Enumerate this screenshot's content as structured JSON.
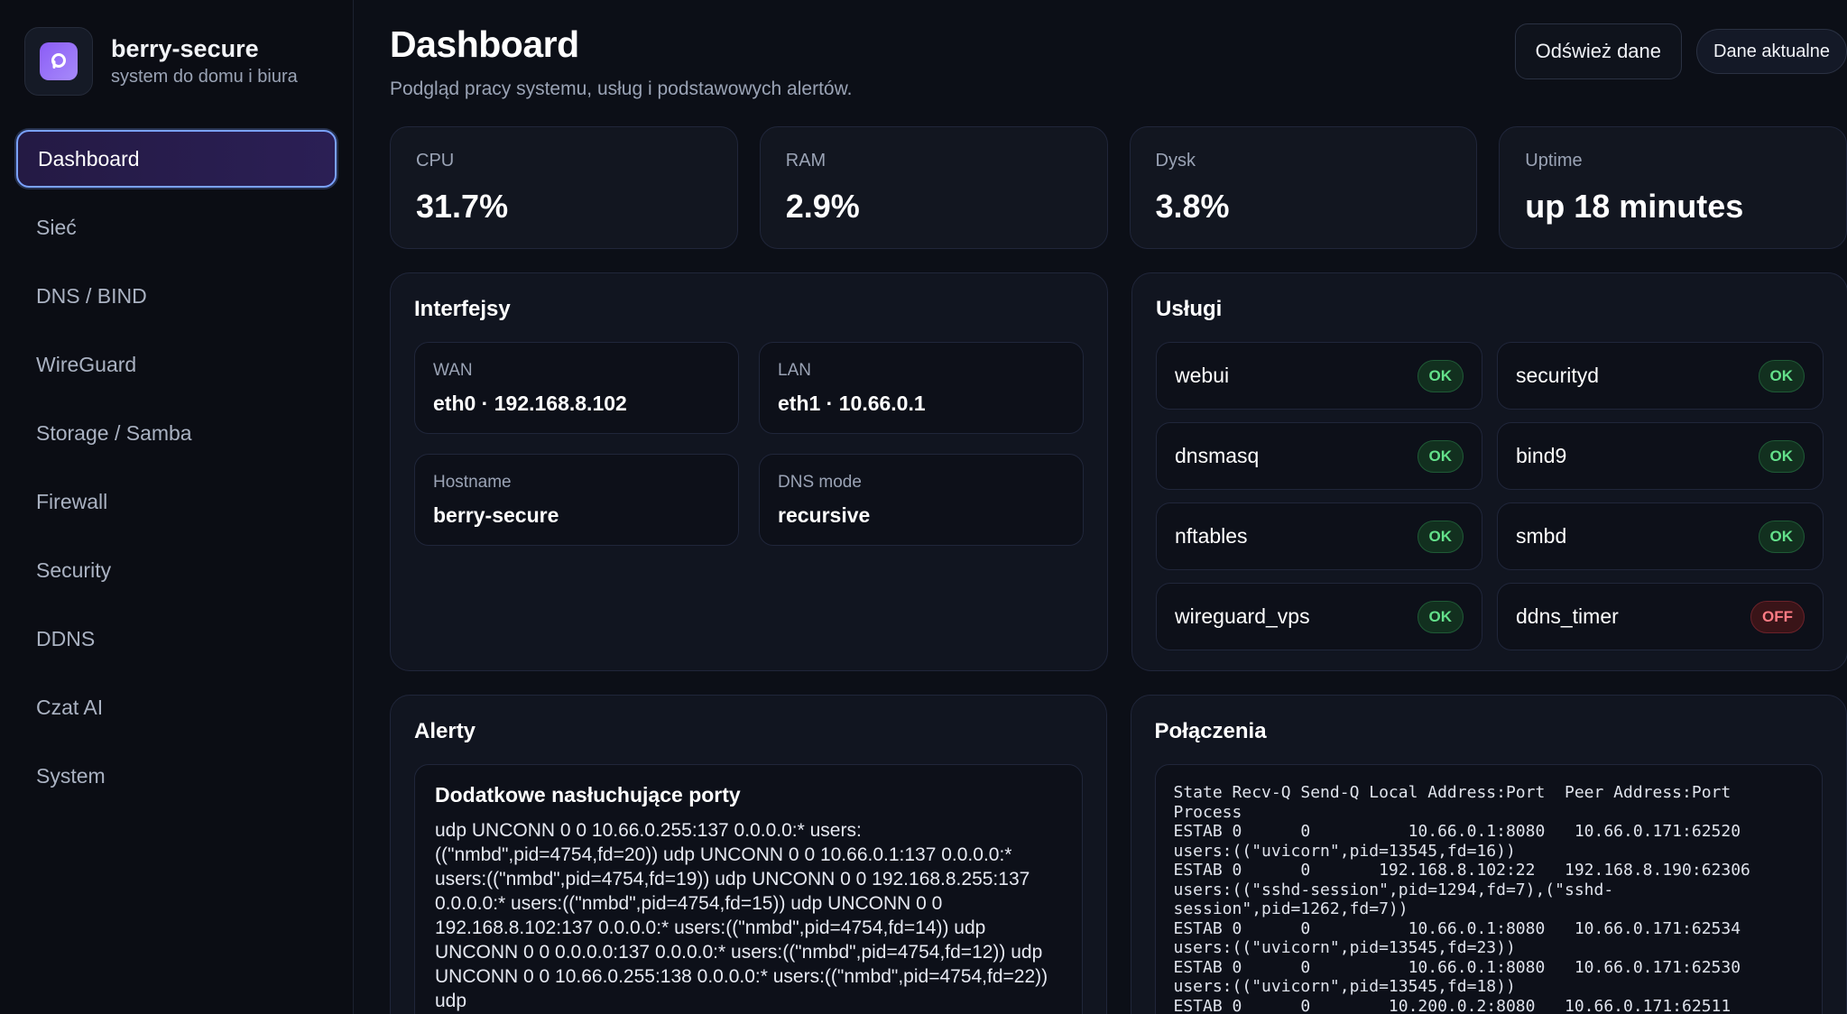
{
  "brand": {
    "name": "berry-secure",
    "subtitle": "system do domu i biura"
  },
  "nav": [
    {
      "label": "Dashboard",
      "active": true
    },
    {
      "label": "Sieć"
    },
    {
      "label": "DNS / BIND"
    },
    {
      "label": "WireGuard"
    },
    {
      "label": "Storage / Samba"
    },
    {
      "label": "Firewall"
    },
    {
      "label": "Security"
    },
    {
      "label": "DDNS"
    },
    {
      "label": "Czat AI"
    },
    {
      "label": "System"
    }
  ],
  "header": {
    "title": "Dashboard",
    "subtitle": "Podgląd pracy systemu, usług i podstawowych alertów.",
    "refresh_label": "Odśwież dane",
    "status_label": "Dane aktualne"
  },
  "stats": [
    {
      "label": "CPU",
      "value": "31.7%"
    },
    {
      "label": "RAM",
      "value": "2.9%"
    },
    {
      "label": "Dysk",
      "value": "3.8%"
    },
    {
      "label": "Uptime",
      "value": "up 18 minutes"
    }
  ],
  "interfaces": {
    "title": "Interfejsy",
    "items": [
      {
        "label": "WAN",
        "value": "eth0 · 192.168.8.102"
      },
      {
        "label": "LAN",
        "value": "eth1 · 10.66.0.1"
      },
      {
        "label": "Hostname",
        "value": "berry-secure"
      },
      {
        "label": "DNS mode",
        "value": "recursive"
      }
    ]
  },
  "services": {
    "title": "Usługi",
    "items": [
      {
        "name": "webui",
        "status": "OK"
      },
      {
        "name": "securityd",
        "status": "OK"
      },
      {
        "name": "dnsmasq",
        "status": "OK"
      },
      {
        "name": "bind9",
        "status": "OK"
      },
      {
        "name": "nftables",
        "status": "OK"
      },
      {
        "name": "smbd",
        "status": "OK"
      },
      {
        "name": "wireguard_vps",
        "status": "OK"
      },
      {
        "name": "ddns_timer",
        "status": "OFF"
      }
    ]
  },
  "alerts": {
    "title": "Alerty",
    "items": [
      {
        "title": "Dodatkowe nasłuchujące porty",
        "text": "udp UNCONN 0 0 10.66.0.255:137 0.0.0.0:* users:((\"nmbd\",pid=4754,fd=20)) udp UNCONN 0 0 10.66.0.1:137 0.0.0.0:* users:((\"nmbd\",pid=4754,fd=19)) udp UNCONN 0 0 192.168.8.255:137 0.0.0.0:* users:((\"nmbd\",pid=4754,fd=15)) udp UNCONN 0 0 192.168.8.102:137 0.0.0.0:* users:((\"nmbd\",pid=4754,fd=14)) udp UNCONN 0 0 0.0.0.0:137 0.0.0.0:* users:((\"nmbd\",pid=4754,fd=12)) udp UNCONN 0 0 10.66.0.255:138 0.0.0.0:* users:((\"nmbd\",pid=4754,fd=22)) udp"
      }
    ]
  },
  "connections": {
    "title": "Połączenia",
    "output": "State Recv-Q Send-Q Local Address:Port  Peer Address:Port\nProcess\nESTAB 0      0          10.66.0.1:8080   10.66.0.171:62520\nusers:((\"uvicorn\",pid=13545,fd=16))\nESTAB 0      0       192.168.8.102:22   192.168.8.190:62306\nusers:((\"sshd-session\",pid=1294,fd=7),(\"sshd-\nsession\",pid=1262,fd=7))\nESTAB 0      0          10.66.0.1:8080   10.66.0.171:62534\nusers:((\"uvicorn\",pid=13545,fd=23))\nESTAB 0      0          10.66.0.1:8080   10.66.0.171:62530\nusers:((\"uvicorn\",pid=13545,fd=18))\nESTAB 0      0        10.200.0.2:8080   10.66.0.171:62511"
  }
}
